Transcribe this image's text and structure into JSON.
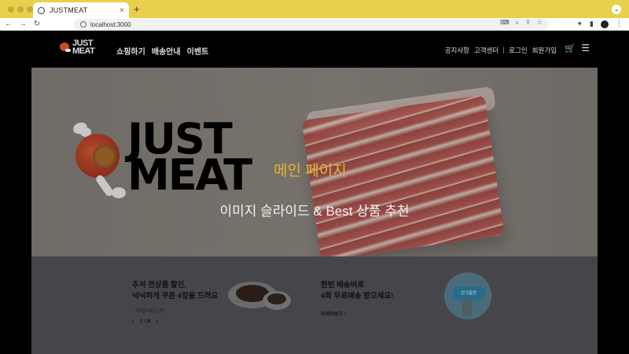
{
  "browser": {
    "tab_title": "JUSTMEAT",
    "tab_close": "×",
    "new_tab": "+",
    "tab_menu": "⌄",
    "url": "localhost:3000"
  },
  "site": {
    "logo_text_line1": "JUST",
    "logo_text_line2": "MEAT",
    "main_nav": [
      "쇼핑하기",
      "배송안내",
      "이벤트"
    ],
    "util_nav": [
      "공지사항",
      "고객센터",
      "로그인",
      "회원가입"
    ],
    "cart_icon": "🛒",
    "menu_icon": "☰"
  },
  "hero": {
    "logo_line1": "JUST",
    "logo_line2": "MEAT",
    "caption1": "메인 페이지",
    "caption2": "이미지 슬라이드 & Best 상품 추천"
  },
  "promo": {
    "card1_title_line1": "추석 전상품 할인,",
    "card1_title_line2": "넉넉하게 쿠폰 4장을 드려요",
    "card1_date": "~ 09월 08일 (목)",
    "pager_prev": "‹",
    "pager_text": "1 / 8",
    "pager_next": "›",
    "card2_title_line1": "한번 배송비로",
    "card2_title_line2": "4회 무료배송 받으세요!",
    "card2_more": "자세히보기 ›",
    "ticket_label": "선거출연"
  }
}
